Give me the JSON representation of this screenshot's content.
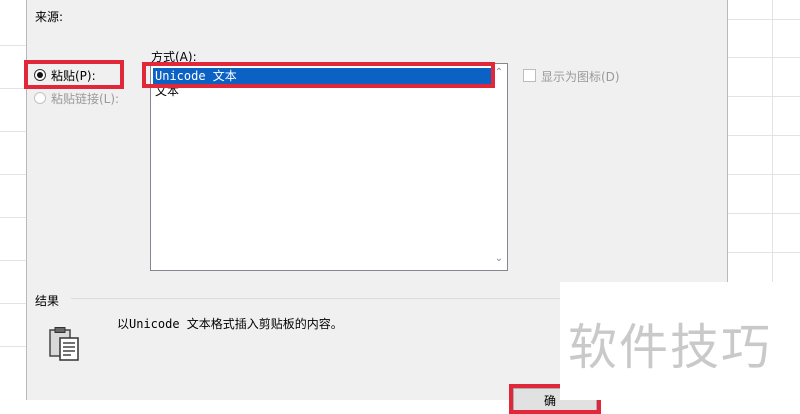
{
  "dialog": {
    "source_label": "来源:",
    "paste_option": "粘贴(P):",
    "paste_link_option": "粘贴链接(L):",
    "method_label": "方式(A):",
    "methods": [
      {
        "label": "Unicode 文本",
        "selected": true
      },
      {
        "label": "文本",
        "selected": false
      }
    ],
    "display_as_icon_label": "显示为图标(D)",
    "display_as_icon_checked": false,
    "result_label": "结果",
    "result_text": "以Unicode 文本格式插入剪贴板的内容。",
    "ok_button_label": "确"
  },
  "watermark": {
    "text": "软件技巧"
  },
  "colors": {
    "highlight": "#e0283a",
    "selection": "#0c62c4",
    "dialog_bg": "#f0f0f0"
  }
}
